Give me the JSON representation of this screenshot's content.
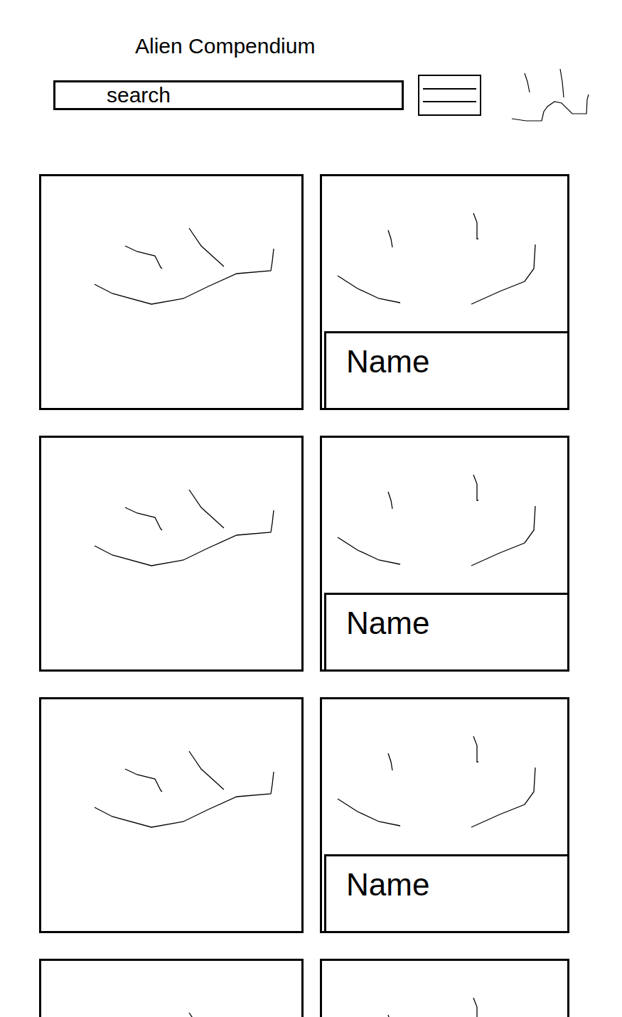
{
  "app": {
    "title": "Alien Compendium"
  },
  "search": {
    "placeholder": "search"
  },
  "cards": [
    {
      "kind": "profile"
    },
    {
      "kind": "front",
      "name": "Name"
    },
    {
      "kind": "profile"
    },
    {
      "kind": "front",
      "name": "Name"
    },
    {
      "kind": "profile"
    },
    {
      "kind": "front",
      "name": "Name"
    },
    {
      "kind": "profile"
    },
    {
      "kind": "front"
    }
  ]
}
